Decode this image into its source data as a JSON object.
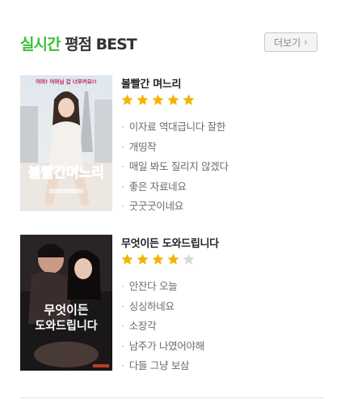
{
  "header": {
    "title_accent": "실시간",
    "title_rest": " 평점 BEST",
    "more_label": "더보기"
  },
  "colors": {
    "accent": "#3dbf3a",
    "star_on": "#f5b400",
    "star_off": "#d9d9d9"
  },
  "items": [
    {
      "title": "볼빨간 며느리",
      "rating": 5,
      "max_rating": 5,
      "poster_text": "볼빨간며느리",
      "poster_tagline": "어머! 어머님 갑 너무커요!!",
      "comments": [
        "이자료 역대급니다 잘한",
        "개띵작",
        "매일 봐도 질리지 않겠다",
        "좋은 자료네요",
        "굿굿굿이네요"
      ]
    },
    {
      "title": "무엇이든 도와드립니다",
      "rating": 4,
      "max_rating": 5,
      "poster_text_line1": "무엇이든",
      "poster_text_line2": "도와드립니다",
      "comments": [
        "안잔다 오늘",
        "싱싱하네요",
        "소장각",
        "남주가 나였어야해",
        "다들 그냥 보삼"
      ]
    }
  ]
}
